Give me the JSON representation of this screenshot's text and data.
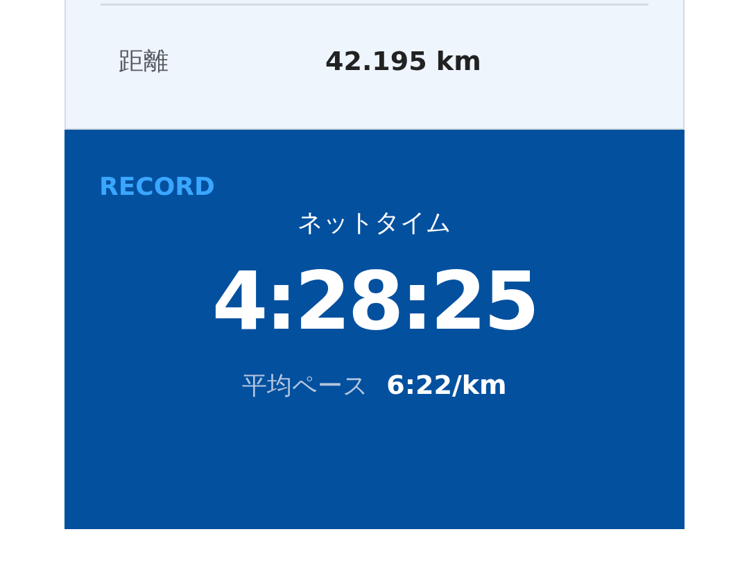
{
  "distance": {
    "label": "距離",
    "value": "42.195 km"
  },
  "record": {
    "heading": "RECORD",
    "net_time_label": "ネットタイム",
    "net_time": "4:28:25",
    "pace_label": "平均ペース",
    "pace": "6:22/km"
  }
}
